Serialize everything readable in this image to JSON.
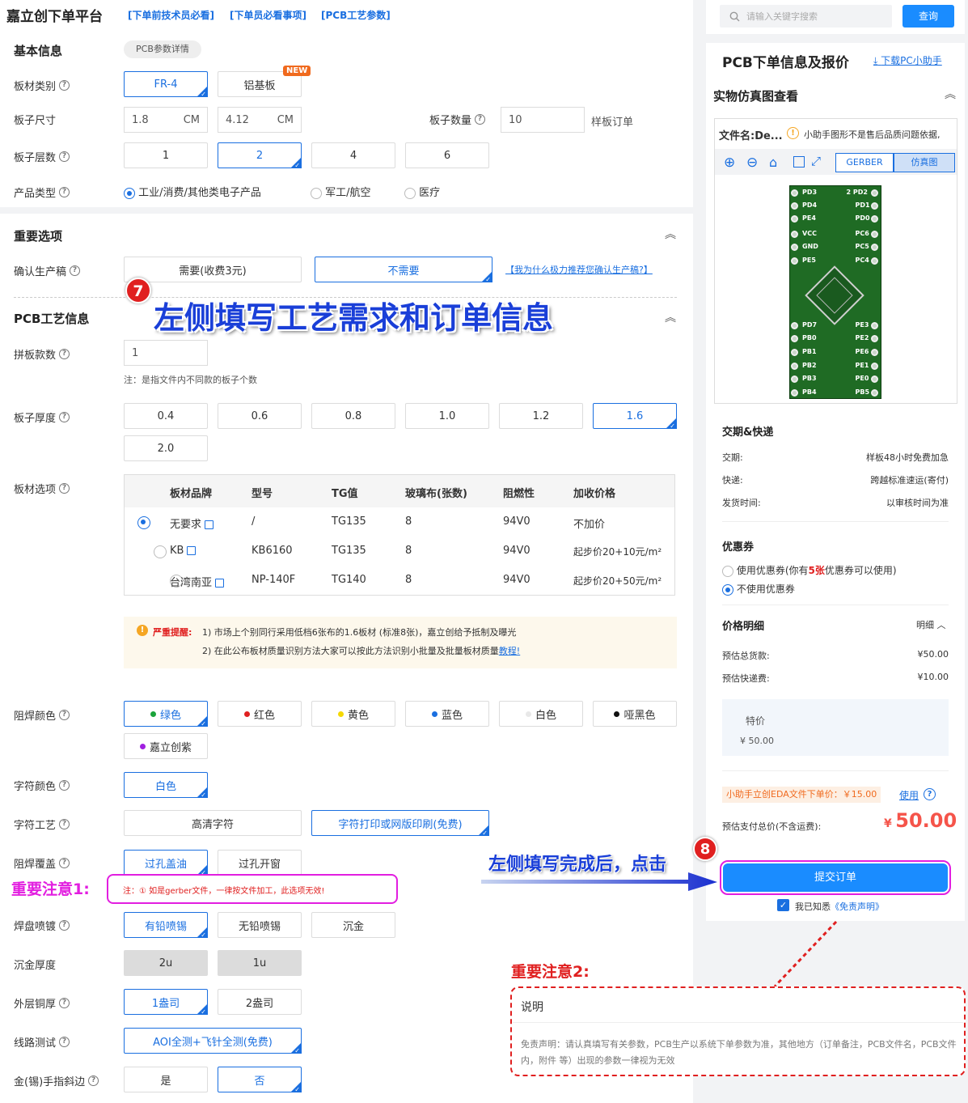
{
  "header": {
    "title": "嘉立创下单平台",
    "links": [
      "[下单前技术员必看]",
      "[下单员必看事项]",
      "[PCB工艺参数]"
    ]
  },
  "basic": {
    "title": "基本信息",
    "detail_tag": "PCB参数详情",
    "material_label": "板材类别",
    "material_opts": [
      "FR-4",
      "铝基板"
    ],
    "new_badge": "NEW",
    "size_label": "板子尺寸",
    "size_w": "1.8",
    "size_h": "4.12",
    "unit": "CM",
    "qty_label": "板子数量",
    "qty_value": "10",
    "qty_note": "样板订单",
    "layers_label": "板子层数",
    "layer_opts": [
      "1",
      "2",
      "4",
      "6"
    ],
    "product_label": "产品类型",
    "product_opts": [
      "工业/消费/其他类电子产品",
      "军工/航空",
      "医疗"
    ]
  },
  "important": {
    "title": "重要选项",
    "confirm_label": "确认生产稿",
    "confirm_opts": [
      "需要(收费3元)",
      "不需要"
    ],
    "why_link": "【我为什么极力推荐您确认生产稿?】"
  },
  "annot7": {
    "num": "7",
    "text": "左侧填写工艺需求和订单信息"
  },
  "process": {
    "title": "PCB工艺信息",
    "panel_label": "拼板款数",
    "panel_value": "1",
    "panel_note": "注：是指文件内不同款的板子个数",
    "thick_label": "板子厚度",
    "thick_opts": [
      "0.4",
      "0.6",
      "0.8",
      "1.0",
      "1.2",
      "1.6",
      "2.0"
    ],
    "board_label": "板材选项",
    "table_headers": [
      "板材品牌",
      "型号",
      "TG值",
      "玻璃布(张数)",
      "阻燃性",
      "加收价格"
    ],
    "table_rows": [
      [
        "无要求",
        "/",
        "TG135",
        "8",
        "94V0",
        "不加价"
      ],
      [
        "KB",
        "KB6160",
        "TG135",
        "8",
        "94V0",
        "起步价20+10元/m²"
      ],
      [
        "台湾南亚",
        "NP-140F",
        "TG140",
        "8",
        "94V0",
        "起步价20+50元/m²"
      ]
    ],
    "warn_title": "严重提醒:",
    "warn1": "1) 市场上个别同行采用低档6张布的1.6板材 (标准8张)，嘉立创给予抵制及曝光",
    "warn2": "2) 在此公布板材质量识别方法大家可以按此方法识别小批量及批量板材质量",
    "warn_link": "教程!",
    "mask_label": "阻焊颜色",
    "mask_opts": [
      "绿色",
      "红色",
      "黄色",
      "蓝色",
      "白色",
      "哑黑色",
      "嘉立创紫"
    ],
    "mask_colors": [
      "#1aa33a",
      "#e02020",
      "#f5d800",
      "#1a6fe0",
      "#e8e8e8",
      "#111111",
      "#a020e0"
    ],
    "silk_label": "字符颜色",
    "silk_opt": "白色",
    "silkproc_label": "字符工艺",
    "silkproc_opts": [
      "高清字符",
      "字符打印或网版印刷(免费)"
    ],
    "cover_label": "阻焊覆盖",
    "cover_opts": [
      "过孔盖油",
      "过孔开窗"
    ],
    "cover_note": "注：① 如是gerber文件，一律按文件加工，此选项无效!",
    "pad_label": "焊盘喷镀",
    "pad_opts": [
      "有铅喷锡",
      "无铅喷锡",
      "沉金"
    ],
    "gold_label": "沉金厚度",
    "gold_opts": [
      "2u",
      "1u"
    ],
    "copper_label": "外层铜厚",
    "copper_opts": [
      "1盎司",
      "2盎司"
    ],
    "test_label": "线路测试",
    "test_opt": "AOI全测+飞针全测(免费)",
    "finger_label": "金(锡)手指斜边",
    "finger_opts": [
      "是",
      "否"
    ]
  },
  "annot_note1": "重要注意1:",
  "right": {
    "search_placeholder": "请输入关键字搜索",
    "search_btn": "查询",
    "title": "PCB下单信息及报价",
    "download": "下载PC小助手",
    "sim_title": "实物仿真图查看",
    "file_name": "文件名:De...",
    "file_warn": "小助手图形不是售后品质问题依据,",
    "tabs": [
      "GERBER",
      "仿真图"
    ],
    "pins_left": [
      "PD3",
      "PD4",
      "PE4",
      "VCC",
      "GND",
      "PE5",
      "PD7",
      "PB0",
      "PB1",
      "PB2",
      "PB3",
      "PB4"
    ],
    "pins_right": [
      "2 PD2",
      "PD1",
      "PD0",
      "PC6",
      "PC5",
      "PC4",
      "PE3",
      "PE2",
      "PE6",
      "PE1",
      "PE0",
      "PB5"
    ],
    "delivery_title": "交期&快递",
    "delivery": [
      [
        "交期:",
        "样板48小时免费加急"
      ],
      [
        "快递:",
        "跨越标准速运(寄付)"
      ],
      [
        "发货时间:",
        "以审核时间为准"
      ]
    ],
    "coupon_title": "优惠券",
    "coupon_use_a": "使用优惠券(你有",
    "coupon_count": "5张",
    "coupon_use_b": "优惠券可以使用)",
    "coupon_none": "不使用优惠券",
    "price_title": "价格明细",
    "price_detail": "明细",
    "prices": [
      [
        "预估总货款:",
        "¥50.00"
      ],
      [
        "预估快递费:",
        "¥10.00"
      ]
    ],
    "special_label": "特价",
    "special_value": "¥ 50.00",
    "eda_text": "小助手立创EDA文件下单价：￥15.00",
    "eda_use": "使用",
    "total_label": "预估支付总价(不含运费):",
    "total_currency": "¥",
    "total_value": "50.00",
    "submit": "提交订单",
    "agree_a": "我已知悉",
    "agree_link": "《免责声明》"
  },
  "annot8": {
    "num": "8",
    "text": "左侧填写完成后，点击"
  },
  "annot_note2": "重要注意2:",
  "disclaimer": {
    "title": "说明",
    "text": "免责声明：请认真填写有关参数，PCB生产以系统下单参数为准，其他地方（订单备注，PCB文件名，PCB文件内，附件 等）出现的参数一律视为无效"
  }
}
